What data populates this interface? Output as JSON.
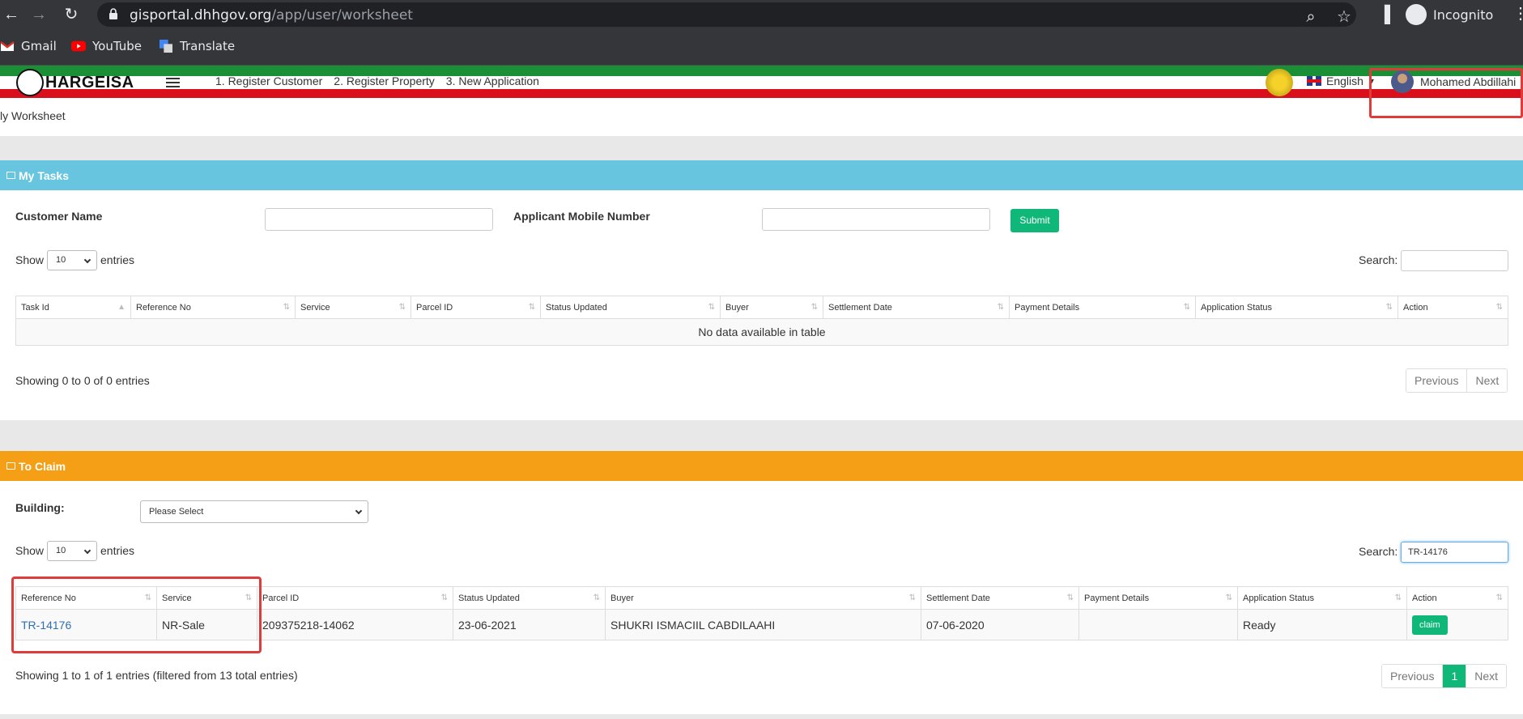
{
  "browser": {
    "url_host": "gisportal.dhhgov.org",
    "url_path": "/app/user/worksheet",
    "profile": "Incognito",
    "bookmarks": [
      "Gmail",
      "YouTube",
      "Translate"
    ]
  },
  "header": {
    "logo_text": "HARGEISA",
    "nav": [
      "1. Register Customer",
      "2. Register Property",
      "3. New Application"
    ],
    "language": "English",
    "user_name": "Mohamed Abdillahi"
  },
  "breadcrumb": "ly Worksheet",
  "my_tasks": {
    "title": "My Tasks",
    "customer_name_label": "Customer Name",
    "mobile_label": "Applicant Mobile Number",
    "submit_label": "Submit",
    "show_label": "Show",
    "entries_value": "10",
    "entries_label": "entries",
    "search_label": "Search:",
    "columns": [
      "Task Id",
      "Reference No",
      "Service",
      "Parcel ID",
      "Status Updated",
      "Buyer",
      "Settlement Date",
      "Payment Details",
      "Application Status",
      "Action"
    ],
    "empty_text": "No data available in table",
    "info": "Showing 0 to 0 of 0 entries",
    "pager": [
      "Previous",
      "Next"
    ]
  },
  "to_claim": {
    "title": "To Claim",
    "building_label": "Building:",
    "building_value": "Please Select",
    "show_label": "Show",
    "entries_value": "10",
    "entries_label": "entries",
    "search_label": "Search:",
    "search_value": "TR-14176",
    "columns": [
      "Reference No",
      "Service",
      "Parcel ID",
      "Status Updated",
      "Buyer",
      "Settlement Date",
      "Payment Details",
      "Application Status",
      "Action"
    ],
    "rows": [
      {
        "reference_no": "TR-14176",
        "service": "NR-Sale",
        "parcel_id": "209375218-14062",
        "status_updated": "23-06-2021",
        "buyer": "SHUKRI ISMACIIL CABDILAAHI",
        "settlement_date": "07-06-2020",
        "payment_details": "",
        "application_status": "Ready",
        "action": "claim"
      }
    ],
    "info": "Showing 1 to 1 of 1 entries (filtered from 13 total entries)",
    "pager": [
      "Previous",
      "1",
      "Next"
    ]
  },
  "colors": {
    "my_tasks_header": "#67c5e0",
    "to_claim_header": "#f49f16",
    "accent_green": "#0fb878",
    "highlight_red": "#e03b3b"
  }
}
